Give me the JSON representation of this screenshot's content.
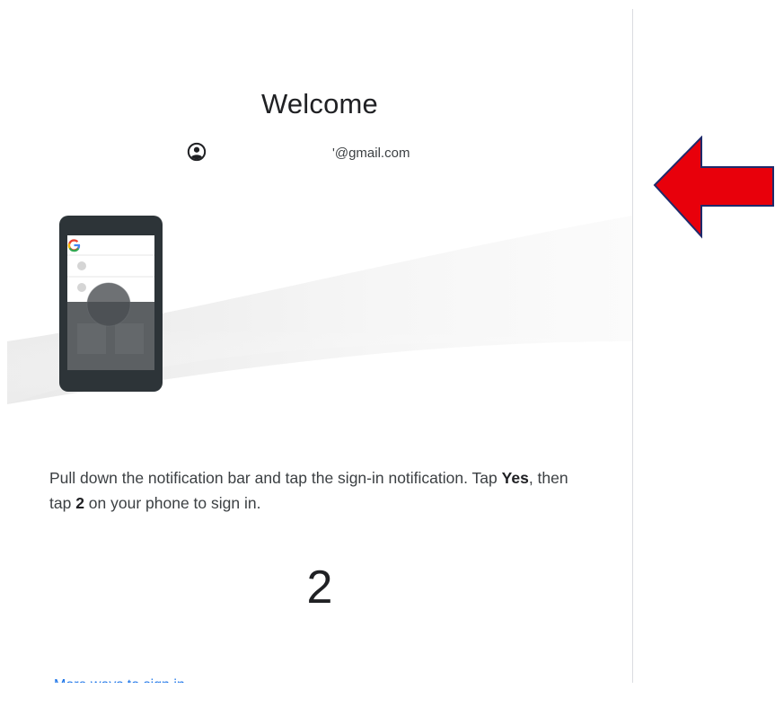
{
  "title": "Welcome",
  "account": {
    "email": "'@gmail.com"
  },
  "instructions": {
    "part1": "Pull down the notification bar and tap the sign-in notification. Tap ",
    "yes": "Yes",
    "part2": ", then tap ",
    "number": "2",
    "part3": " on your phone to sign in."
  },
  "match_number": "2",
  "more_ways_link": "More ways to sign in",
  "colors": {
    "arrow": "#e8000b",
    "arrow_outline": "#1f2a6b",
    "link": "#1a73e8",
    "phone_frame": "#2d3438"
  },
  "icons": {
    "avatar": "account-circle-icon",
    "arrow": "left-arrow-icon",
    "google": "google-g-icon"
  }
}
